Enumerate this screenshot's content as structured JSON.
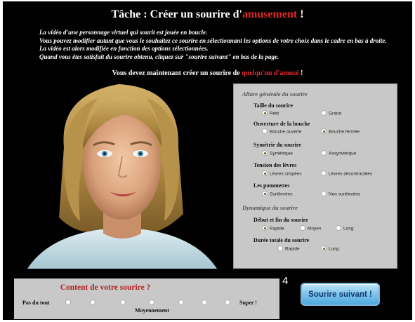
{
  "header": {
    "title_prefix": "Tâche : Créer un sourire d'",
    "title_highlight": "amusement",
    "title_suffix": " !"
  },
  "instructions": [
    "La vidéo d'une personnage virtuel qui sourit est jouée en boucle.",
    "Vous pouvez modifier autant que vous le souhaitez ce sourire en sélectionnant les options de votre choix dans le cadre en bas à droite.",
    "La vidéo est alors modifiée en fonction des options sélectionnées.",
    "Quand vous êtes satisfait du sourire obtenu, cliquez sur \"sourire suivant\" en bas de la page."
  ],
  "prompt": {
    "prefix": "Vous devez maintenant créer un sourire de ",
    "highlight": "quelqu'un d'amusé",
    "suffix": " !"
  },
  "options": {
    "section_general": "Allure générale du sourire",
    "taille": {
      "label": "Taille du sourire",
      "opt1": "Petit",
      "opt2": "Grand",
      "selected": "Petit"
    },
    "ouverture": {
      "label": "Ouverture de la bouche",
      "opt1": "Bouche ouverte",
      "opt2": "Bouche fermée",
      "selected": "Bouche fermée"
    },
    "symetrie": {
      "label": "Symétrie du sourire",
      "opt1": "Symétrique",
      "opt2": "Assymétrique",
      "selected": "Symétrique"
    },
    "tension": {
      "label": "Tension des lèvres",
      "opt1": "Lèvres crispées",
      "opt2": "Lèvres décontractées",
      "selected": "Lèvres crispées"
    },
    "pommettes": {
      "label": "Les pommettes",
      "opt1": "Surélevées",
      "opt2": "Non surélevées",
      "selected": "Surélevées"
    },
    "section_dynamique": "Dynamique du sourire",
    "debut": {
      "label": "Début et fin du sourire",
      "opt1": "Rapide",
      "opt2": "Moyen",
      "opt3": "Long",
      "selected": "Rapide"
    },
    "duree": {
      "label": "Durée totale du sourire",
      "opt1": "Rapide",
      "opt2": "Long",
      "selected": "Long"
    }
  },
  "rating": {
    "question": "Content de votre sourire ?",
    "low": "Pas du tout",
    "mid": "Moyennement",
    "high": "Super !",
    "points": 7
  },
  "page_number": "4",
  "next_button": "Sourire suivant !",
  "colors": {
    "highlight": "#e02a2a",
    "panel": "#c8c8c8",
    "button": "#7cc3ec"
  }
}
